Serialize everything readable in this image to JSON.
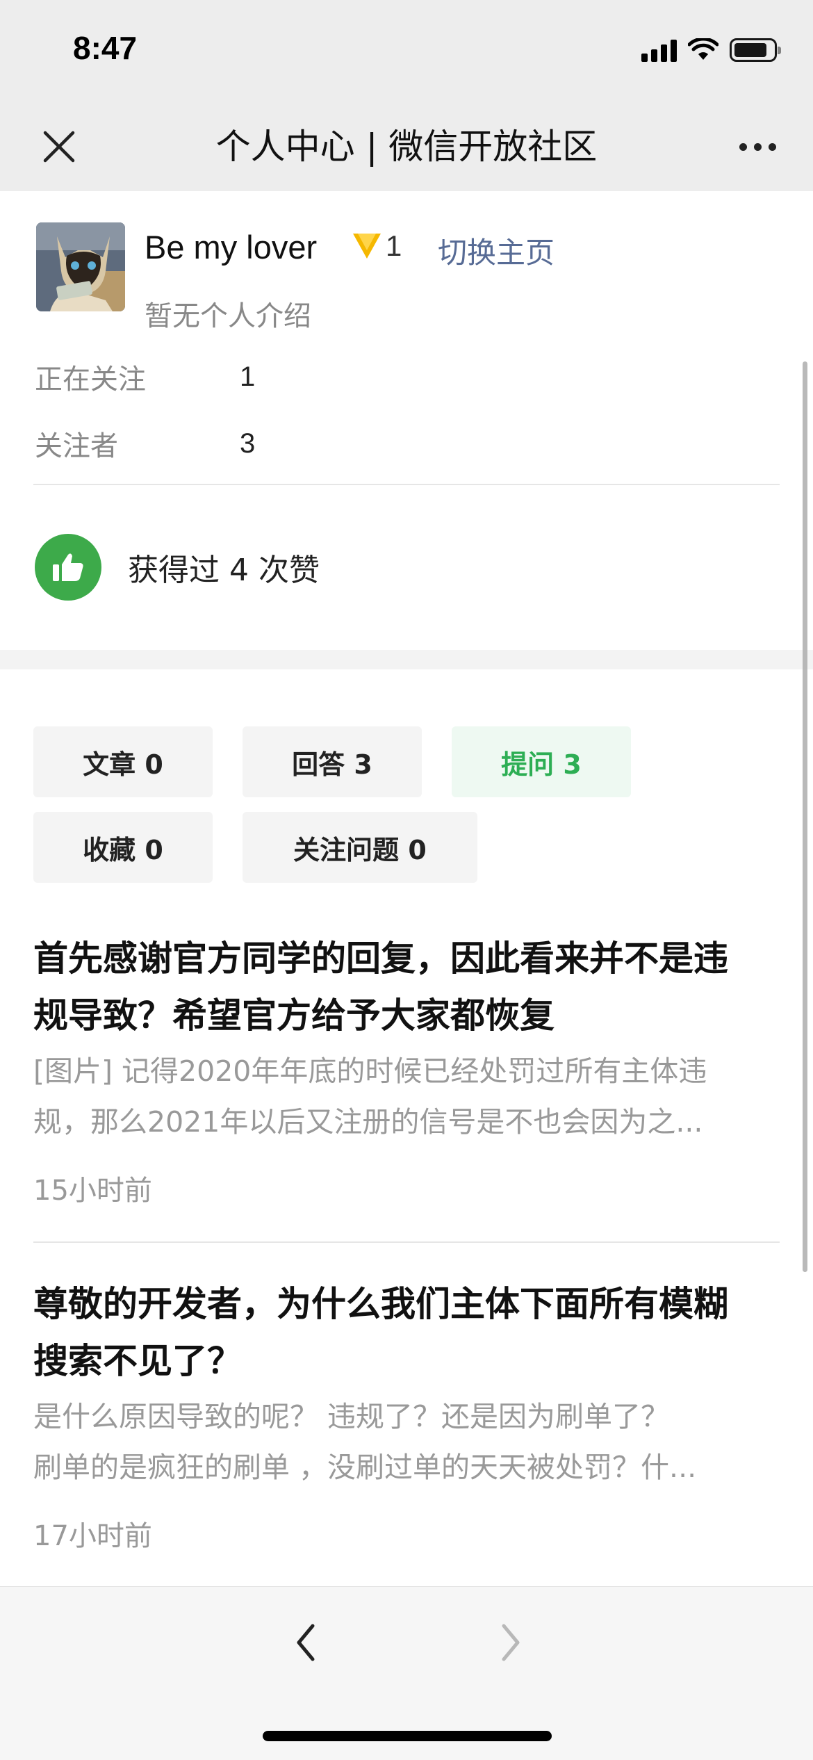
{
  "status_bar": {
    "time": "8:47"
  },
  "nav": {
    "title": "个人中心 | 微信开放社区"
  },
  "profile": {
    "username": "Be my lover",
    "badge_count": "1",
    "switch_label": "切换主页",
    "bio": "暂无个人介绍",
    "following_label": "正在关注",
    "following_value": "1",
    "followers_label": "关注者",
    "followers_value": "3",
    "likes_text": "获得过 4 次赞"
  },
  "tabs": [
    {
      "label": "文章 0",
      "active": false
    },
    {
      "label": "回答 3",
      "active": false
    },
    {
      "label": "提问 3",
      "active": true
    },
    {
      "label": "收藏 0",
      "active": false
    },
    {
      "label": "关注问题 0",
      "active": false
    }
  ],
  "questions": [
    {
      "title_line1": "首先感谢官方同学的回复，因此看来并不是违",
      "title_line2": "规导致？希望官方给予大家都恢复",
      "excerpt_line1": "[图片] 记得2020年年底的时候已经处罚过所有主体违",
      "excerpt_line2": "规，那么2021年以后又注册的信号是不也会因为之...",
      "time": "15小时前"
    },
    {
      "title_line1": "尊敬的开发者，为什么我们主体下面所有模糊",
      "title_line2": "搜索不见了？",
      "excerpt_line1": "是什么原因导致的呢？ 违规了？还是因为刷单了？",
      "excerpt_line2": "刷单的是疯狂的刷单 ，没刷过单的天天被处罚？什...",
      "time": "17小时前"
    }
  ],
  "colors": {
    "accent_green": "#2dae54",
    "link_blue": "#576b95",
    "like_green": "#3daa4a",
    "badge_gold": "#f5b800"
  },
  "icons": [
    "close-icon",
    "more-icon",
    "badge-icon",
    "thumbs-up-icon",
    "back-arrow-icon",
    "forward-arrow-icon"
  ]
}
